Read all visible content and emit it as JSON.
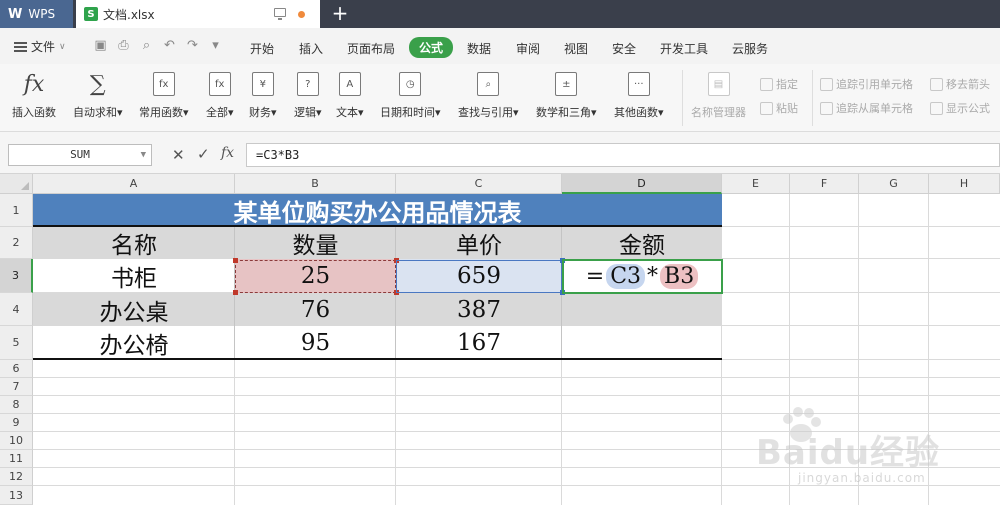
{
  "titlebar": {
    "app_tab": "WPS",
    "doc_tab": "文档.xlsx",
    "new_tab": "+"
  },
  "menubar": {
    "file": "文件",
    "items": [
      "开始",
      "插入",
      "页面布局",
      "公式",
      "数据",
      "审阅",
      "视图",
      "安全",
      "开发工具",
      "云服务"
    ],
    "active": "公式"
  },
  "ribbon": {
    "buttons": [
      "插入函数",
      "自动求和",
      "常用函数",
      "全部",
      "财务",
      "逻辑",
      "文本",
      "日期和时间",
      "查找与引用",
      "数学和三角",
      "其他函数",
      "名称管理器"
    ],
    "small_buttons": [
      "指定",
      "粘贴",
      "追踪引用单元格",
      "移去箭头",
      "追踪从属单元格",
      "显示公式"
    ]
  },
  "formulabar": {
    "namebox": "SUM",
    "fx": "fx",
    "formula": "=C3*B3"
  },
  "grid": {
    "columns": [
      "A",
      "B",
      "C",
      "D",
      "E",
      "F",
      "G",
      "H"
    ],
    "selected_column": "D",
    "rows": [
      "1",
      "2",
      "3",
      "4",
      "5",
      "6",
      "7",
      "8",
      "9",
      "10",
      "11",
      "12",
      "13"
    ],
    "selected_row": "3"
  },
  "sheet": {
    "title": "某单位购买办公用品情况表",
    "headers": [
      "名称",
      "数量",
      "单价",
      "金额"
    ],
    "rows": [
      {
        "name": "书柜",
        "qty": "25",
        "price": "659"
      },
      {
        "name": "办公桌",
        "qty": "76",
        "price": "387"
      },
      {
        "name": "办公椅",
        "qty": "95",
        "price": "167"
      }
    ],
    "d3_formula": {
      "eq": "=",
      "ref1": "C3",
      "op": "*",
      "ref2": "B3"
    }
  },
  "colors": {
    "accent": "#3aa04a",
    "title_fill": "#4f81bd",
    "b3_fill": "#e7c3c4",
    "c3_fill": "#dae3f1"
  },
  "watermark": {
    "brand": "Baidu经验",
    "url": "jingyan.baidu.com"
  }
}
